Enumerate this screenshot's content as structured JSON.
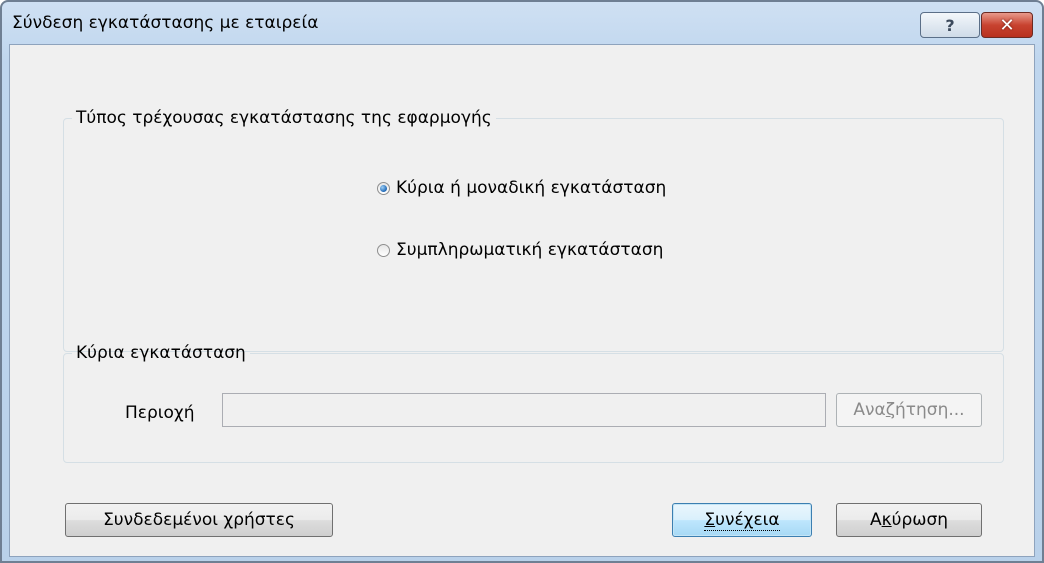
{
  "window": {
    "title": "Σύνδεση εγκατάστασης με εταιρεία",
    "help_glyph": "?",
    "close_glyph": "✕"
  },
  "install_type": {
    "legend": "Τύπος τρέχουσας εγκατάστασης της εφαρμογής",
    "options": [
      {
        "label": "Κύρια ή μοναδική εγκατάσταση",
        "selected": true
      },
      {
        "label": "Συμπληρωματική εγκατάσταση",
        "selected": false
      }
    ]
  },
  "main_install": {
    "legend": "Κύρια εγκατάσταση",
    "area_label": "Περιοχή",
    "area_value": "",
    "search_button": {
      "pre": "Ανα",
      "mnemonic": "ζ",
      "post": "ήτηση..."
    }
  },
  "buttons": {
    "connected_users": "Συνδεδεμένοι χρήστες",
    "continue": {
      "pre": "",
      "mnemonic": "Σ",
      "post": "υνέχεια"
    },
    "cancel": {
      "pre": "Α",
      "mnemonic": "κ",
      "post": "ύρωση"
    }
  },
  "colors": {
    "title_gradient": "#bfd6ee",
    "client_bg": "#f0f0f0",
    "radio_selected": "#1d66b5",
    "close_button": "#c84330"
  }
}
